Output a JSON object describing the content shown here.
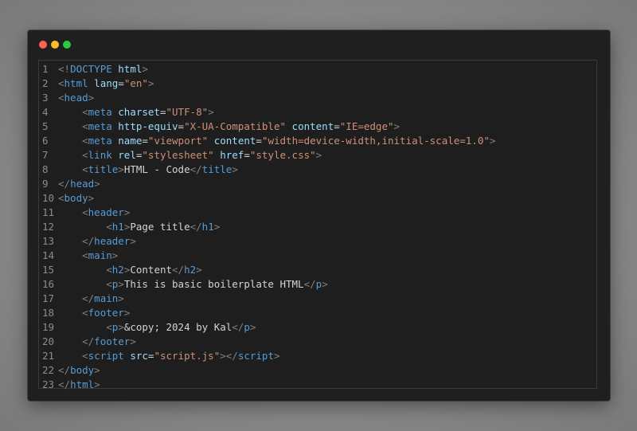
{
  "window": {
    "controls": [
      {
        "name": "close",
        "color": "#ff5f57"
      },
      {
        "name": "minimize",
        "color": "#febc2e"
      },
      {
        "name": "maximize",
        "color": "#28c840"
      }
    ]
  },
  "editor": {
    "language": "html",
    "lines": [
      {
        "n": "1",
        "indent": "",
        "tokens": [
          [
            "p",
            "<!"
          ],
          [
            "t",
            "DOCTYPE"
          ],
          [
            "x",
            " "
          ],
          [
            "a",
            "html"
          ],
          [
            "p",
            ">"
          ]
        ]
      },
      {
        "n": "2",
        "indent": "",
        "tokens": [
          [
            "p",
            "<"
          ],
          [
            "t",
            "html"
          ],
          [
            "x",
            " "
          ],
          [
            "a",
            "lang"
          ],
          [
            "x",
            "="
          ],
          [
            "s",
            "\"en\""
          ],
          [
            "p",
            ">"
          ]
        ]
      },
      {
        "n": "3",
        "indent": "",
        "tokens": [
          [
            "p",
            "<"
          ],
          [
            "t",
            "head"
          ],
          [
            "p",
            ">"
          ]
        ]
      },
      {
        "n": "4",
        "indent": "    ",
        "tokens": [
          [
            "p",
            "<"
          ],
          [
            "t",
            "meta"
          ],
          [
            "x",
            " "
          ],
          [
            "a",
            "charset"
          ],
          [
            "x",
            "="
          ],
          [
            "s",
            "\"UTF-8\""
          ],
          [
            "p",
            ">"
          ]
        ]
      },
      {
        "n": "5",
        "indent": "    ",
        "tokens": [
          [
            "p",
            "<"
          ],
          [
            "t",
            "meta"
          ],
          [
            "x",
            " "
          ],
          [
            "a",
            "http-equiv"
          ],
          [
            "x",
            "="
          ],
          [
            "s",
            "\"X-UA-Compatible\""
          ],
          [
            "x",
            " "
          ],
          [
            "a",
            "content"
          ],
          [
            "x",
            "="
          ],
          [
            "s",
            "\"IE=edge\""
          ],
          [
            "p",
            ">"
          ]
        ]
      },
      {
        "n": "6",
        "indent": "    ",
        "tokens": [
          [
            "p",
            "<"
          ],
          [
            "t",
            "meta"
          ],
          [
            "x",
            " "
          ],
          [
            "a",
            "name"
          ],
          [
            "x",
            "="
          ],
          [
            "s",
            "\"viewport\""
          ],
          [
            "x",
            " "
          ],
          [
            "a",
            "content"
          ],
          [
            "x",
            "="
          ],
          [
            "s",
            "\"width=device-width,initial-scale=1.0\""
          ],
          [
            "p",
            ">"
          ]
        ]
      },
      {
        "n": "7",
        "indent": "    ",
        "tokens": [
          [
            "p",
            "<"
          ],
          [
            "t",
            "link"
          ],
          [
            "x",
            " "
          ],
          [
            "a",
            "rel"
          ],
          [
            "x",
            "="
          ],
          [
            "s",
            "\"stylesheet\""
          ],
          [
            "x",
            " "
          ],
          [
            "a",
            "href"
          ],
          [
            "x",
            "="
          ],
          [
            "s",
            "\"style.css\""
          ],
          [
            "p",
            ">"
          ]
        ]
      },
      {
        "n": "8",
        "indent": "    ",
        "tokens": [
          [
            "p",
            "<"
          ],
          [
            "t",
            "title"
          ],
          [
            "p",
            ">"
          ],
          [
            "x",
            "HTML - Code"
          ],
          [
            "p",
            "</"
          ],
          [
            "t",
            "title"
          ],
          [
            "p",
            ">"
          ]
        ]
      },
      {
        "n": "9",
        "indent": "",
        "tokens": [
          [
            "p",
            "</"
          ],
          [
            "t",
            "head"
          ],
          [
            "p",
            ">"
          ]
        ]
      },
      {
        "n": "10",
        "indent": "",
        "tokens": [
          [
            "p",
            "<"
          ],
          [
            "t",
            "body"
          ],
          [
            "p",
            ">"
          ]
        ]
      },
      {
        "n": "11",
        "indent": "    ",
        "tokens": [
          [
            "p",
            "<"
          ],
          [
            "t",
            "header"
          ],
          [
            "p",
            ">"
          ]
        ]
      },
      {
        "n": "12",
        "indent": "        ",
        "tokens": [
          [
            "p",
            "<"
          ],
          [
            "t",
            "h1"
          ],
          [
            "p",
            ">"
          ],
          [
            "x",
            "Page title"
          ],
          [
            "p",
            "</"
          ],
          [
            "t",
            "h1"
          ],
          [
            "p",
            ">"
          ]
        ]
      },
      {
        "n": "13",
        "indent": "    ",
        "tokens": [
          [
            "p",
            "</"
          ],
          [
            "t",
            "header"
          ],
          [
            "p",
            ">"
          ]
        ]
      },
      {
        "n": "14",
        "indent": "    ",
        "tokens": [
          [
            "p",
            "<"
          ],
          [
            "t",
            "main"
          ],
          [
            "p",
            ">"
          ]
        ]
      },
      {
        "n": "15",
        "indent": "        ",
        "tokens": [
          [
            "p",
            "<"
          ],
          [
            "t",
            "h2"
          ],
          [
            "p",
            ">"
          ],
          [
            "x",
            "Content"
          ],
          [
            "p",
            "</"
          ],
          [
            "t",
            "h2"
          ],
          [
            "p",
            ">"
          ]
        ]
      },
      {
        "n": "16",
        "indent": "        ",
        "tokens": [
          [
            "p",
            "<"
          ],
          [
            "t",
            "p"
          ],
          [
            "p",
            ">"
          ],
          [
            "x",
            "This is basic boilerplate HTML"
          ],
          [
            "p",
            "</"
          ],
          [
            "t",
            "p"
          ],
          [
            "p",
            ">"
          ]
        ]
      },
      {
        "n": "17",
        "indent": "    ",
        "tokens": [
          [
            "p",
            "</"
          ],
          [
            "t",
            "main"
          ],
          [
            "p",
            ">"
          ]
        ]
      },
      {
        "n": "18",
        "indent": "    ",
        "tokens": [
          [
            "p",
            "<"
          ],
          [
            "t",
            "footer"
          ],
          [
            "p",
            ">"
          ]
        ]
      },
      {
        "n": "19",
        "indent": "        ",
        "tokens": [
          [
            "p",
            "<"
          ],
          [
            "t",
            "p"
          ],
          [
            "p",
            ">"
          ],
          [
            "x",
            "&copy; 2024 by Kal"
          ],
          [
            "p",
            "</"
          ],
          [
            "t",
            "p"
          ],
          [
            "p",
            ">"
          ]
        ]
      },
      {
        "n": "20",
        "indent": "    ",
        "tokens": [
          [
            "p",
            "</"
          ],
          [
            "t",
            "footer"
          ],
          [
            "p",
            ">"
          ]
        ]
      },
      {
        "n": "21",
        "indent": "    ",
        "tokens": [
          [
            "p",
            "<"
          ],
          [
            "t",
            "script"
          ],
          [
            "x",
            " "
          ],
          [
            "a",
            "src"
          ],
          [
            "x",
            "="
          ],
          [
            "s",
            "\"script.js\""
          ],
          [
            "p",
            "></"
          ],
          [
            "t",
            "script"
          ],
          [
            "p",
            ">"
          ]
        ]
      },
      {
        "n": "22",
        "indent": "",
        "tokens": [
          [
            "p",
            "</"
          ],
          [
            "t",
            "body"
          ],
          [
            "p",
            ">"
          ]
        ]
      },
      {
        "n": "23",
        "indent": "",
        "tokens": [
          [
            "p",
            "</"
          ],
          [
            "t",
            "html"
          ],
          [
            "p",
            ">"
          ]
        ]
      }
    ]
  }
}
